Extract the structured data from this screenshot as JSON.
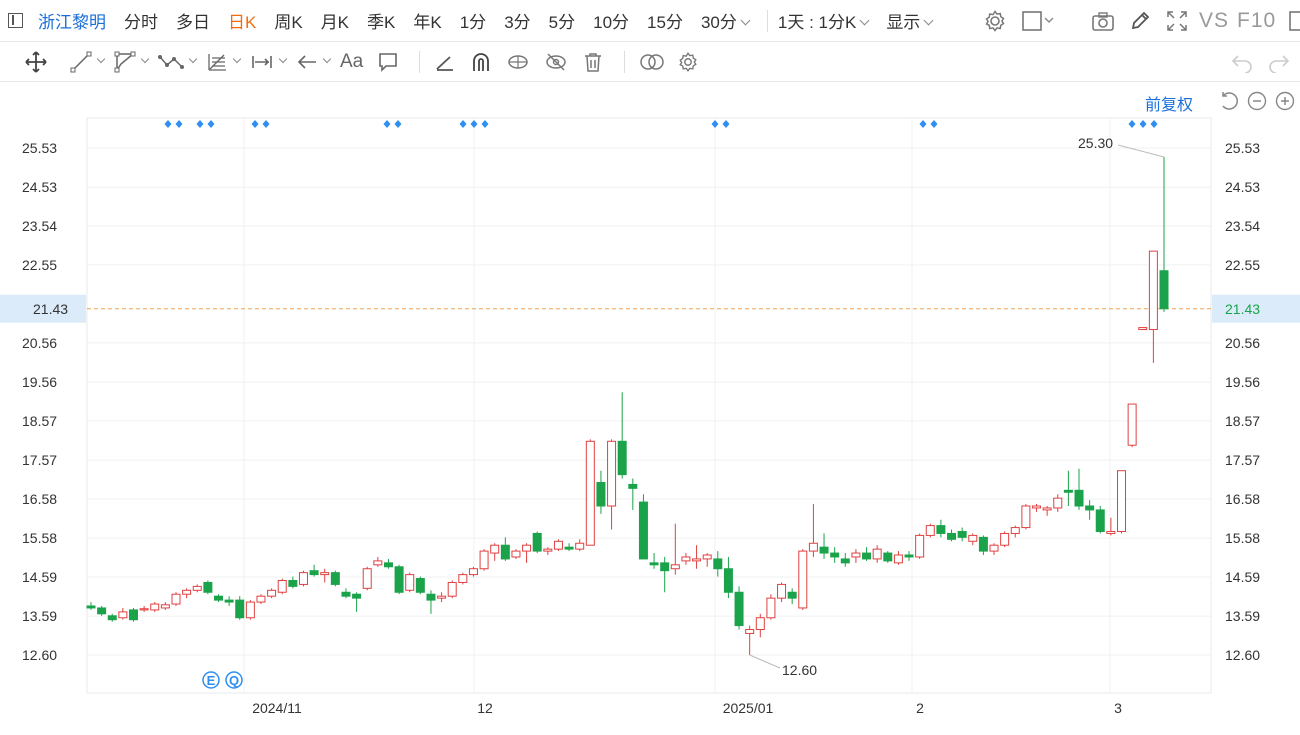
{
  "toolbar": {
    "stock_name": "浙江黎明",
    "periods": [
      "分时",
      "多日",
      "日K",
      "周K",
      "月K",
      "季K",
      "年K",
      "1分",
      "3分",
      "5分",
      "10分",
      "15分",
      "30分"
    ],
    "active_period": "日K",
    "combo": "1天 : 1分K",
    "display": "显示",
    "vs": "VS",
    "f10": "F10"
  },
  "drawing_tools": {
    "text_tool": "Aa"
  },
  "chart": {
    "adjust_label": "前复权",
    "current_price": "21.43",
    "high_label": "25.30",
    "low_label": "12.60"
  },
  "chart_data": {
    "type": "candlestick",
    "y_ticks": [
      "25.53",
      "24.53",
      "23.54",
      "22.55",
      "20.56",
      "19.56",
      "18.57",
      "17.57",
      "16.58",
      "15.58",
      "14.59",
      "13.59",
      "12.60"
    ],
    "x_labels": [
      "2024/11",
      "12",
      "2025/01",
      "2",
      "3"
    ],
    "current_price": 21.43,
    "max_label": 25.3,
    "min_label": 12.6,
    "colors": {
      "up": "#e04040",
      "down": "#1aa34a",
      "price_line": "#f0a050",
      "grid": "#f0f0f0"
    },
    "candles": [
      [
        13.85,
        13.95,
        13.75,
        13.8
      ],
      [
        13.8,
        13.85,
        13.6,
        13.65
      ],
      [
        13.6,
        13.65,
        13.45,
        13.5
      ],
      [
        13.55,
        13.8,
        13.5,
        13.7
      ],
      [
        13.75,
        13.8,
        13.45,
        13.5
      ],
      [
        13.75,
        13.85,
        13.7,
        13.78
      ],
      [
        13.75,
        13.95,
        13.7,
        13.9
      ],
      [
        13.8,
        13.95,
        13.75,
        13.88
      ],
      [
        13.9,
        14.2,
        13.85,
        14.15
      ],
      [
        14.15,
        14.3,
        14.05,
        14.25
      ],
      [
        14.25,
        14.4,
        14.2,
        14.35
      ],
      [
        14.45,
        14.5,
        14.15,
        14.2
      ],
      [
        14.1,
        14.15,
        13.95,
        14.0
      ],
      [
        14.0,
        14.1,
        13.85,
        13.95
      ],
      [
        14.0,
        14.1,
        13.5,
        13.55
      ],
      [
        13.55,
        14.0,
        13.5,
        13.95
      ],
      [
        13.95,
        14.15,
        13.9,
        14.1
      ],
      [
        14.1,
        14.3,
        14.05,
        14.25
      ],
      [
        14.2,
        14.55,
        14.15,
        14.5
      ],
      [
        14.5,
        14.6,
        14.3,
        14.35
      ],
      [
        14.4,
        14.75,
        14.35,
        14.7
      ],
      [
        14.75,
        14.9,
        14.6,
        14.65
      ],
      [
        14.65,
        14.8,
        14.45,
        14.7
      ],
      [
        14.7,
        14.75,
        14.35,
        14.4
      ],
      [
        14.2,
        14.3,
        14.05,
        14.1
      ],
      [
        14.15,
        14.2,
        13.7,
        14.05
      ],
      [
        14.3,
        14.85,
        14.25,
        14.8
      ],
      [
        14.9,
        15.1,
        14.85,
        15.0
      ],
      [
        14.95,
        15.05,
        14.8,
        14.85
      ],
      [
        14.85,
        14.9,
        14.15,
        14.2
      ],
      [
        14.25,
        14.7,
        14.2,
        14.65
      ],
      [
        14.55,
        14.6,
        14.15,
        14.2
      ],
      [
        14.15,
        14.25,
        13.65,
        14.0
      ],
      [
        14.05,
        14.2,
        13.95,
        14.1
      ],
      [
        14.1,
        14.5,
        14.05,
        14.45
      ],
      [
        14.45,
        14.7,
        14.4,
        14.65
      ],
      [
        14.65,
        14.85,
        14.6,
        14.8
      ],
      [
        14.8,
        15.3,
        14.75,
        15.25
      ],
      [
        15.2,
        15.45,
        15.0,
        15.4
      ],
      [
        15.4,
        15.6,
        15.0,
        15.05
      ],
      [
        15.1,
        15.3,
        15.05,
        15.25
      ],
      [
        15.25,
        15.45,
        14.95,
        15.4
      ],
      [
        15.7,
        15.75,
        15.2,
        15.25
      ],
      [
        15.25,
        15.35,
        15.15,
        15.3
      ],
      [
        15.3,
        15.55,
        15.25,
        15.5
      ],
      [
        15.35,
        15.45,
        15.25,
        15.3
      ],
      [
        15.3,
        15.55,
        15.25,
        15.45
      ],
      [
        15.4,
        18.1,
        15.4,
        18.05
      ],
      [
        17.0,
        17.3,
        16.2,
        16.4
      ],
      [
        16.4,
        18.1,
        15.8,
        18.05
      ],
      [
        18.05,
        19.3,
        17.1,
        17.2
      ],
      [
        16.95,
        17.1,
        16.3,
        16.85
      ],
      [
        16.5,
        16.7,
        15.1,
        15.05
      ],
      [
        14.95,
        15.2,
        14.8,
        14.9
      ],
      [
        14.95,
        15.1,
        14.2,
        14.75
      ],
      [
        14.8,
        15.95,
        14.65,
        14.9
      ],
      [
        15.0,
        15.2,
        14.9,
        15.1
      ],
      [
        15.0,
        15.4,
        14.8,
        15.05
      ],
      [
        15.05,
        15.2,
        14.85,
        15.15
      ],
      [
        15.05,
        15.25,
        14.6,
        14.8
      ],
      [
        14.8,
        15.1,
        14.05,
        14.2
      ],
      [
        14.2,
        14.35,
        13.25,
        13.35
      ],
      [
        13.15,
        13.35,
        12.6,
        13.25
      ],
      [
        13.25,
        13.65,
        13.05,
        13.55
      ],
      [
        13.55,
        14.15,
        13.5,
        14.05
      ],
      [
        14.05,
        14.45,
        13.95,
        14.4
      ],
      [
        14.2,
        14.3,
        13.9,
        14.05
      ],
      [
        13.8,
        15.3,
        13.75,
        15.25
      ],
      [
        15.25,
        16.45,
        15.1,
        15.45
      ],
      [
        15.35,
        15.7,
        15.05,
        15.2
      ],
      [
        15.2,
        15.35,
        14.95,
        15.1
      ],
      [
        15.05,
        15.2,
        14.85,
        14.95
      ],
      [
        15.1,
        15.3,
        14.95,
        15.2
      ],
      [
        15.2,
        15.35,
        15.0,
        15.05
      ],
      [
        15.05,
        15.4,
        14.95,
        15.3
      ],
      [
        15.2,
        15.25,
        14.95,
        15.0
      ],
      [
        14.95,
        15.25,
        14.9,
        15.15
      ],
      [
        15.15,
        15.25,
        15.0,
        15.1
      ],
      [
        15.1,
        15.7,
        15.05,
        15.65
      ],
      [
        15.65,
        15.95,
        15.6,
        15.9
      ],
      [
        15.9,
        16.05,
        15.6,
        15.7
      ],
      [
        15.7,
        15.8,
        15.5,
        15.55
      ],
      [
        15.75,
        15.85,
        15.5,
        15.6
      ],
      [
        15.5,
        15.7,
        15.4,
        15.65
      ],
      [
        15.6,
        15.65,
        15.15,
        15.25
      ],
      [
        15.25,
        15.45,
        15.15,
        15.4
      ],
      [
        15.4,
        15.75,
        15.35,
        15.7
      ],
      [
        15.7,
        15.9,
        15.6,
        15.85
      ],
      [
        15.85,
        16.45,
        15.8,
        16.4
      ],
      [
        16.35,
        16.45,
        16.25,
        16.4
      ],
      [
        16.3,
        16.4,
        16.15,
        16.35
      ],
      [
        16.35,
        16.7,
        16.25,
        16.6
      ],
      [
        16.8,
        17.3,
        16.4,
        16.75
      ],
      [
        16.8,
        17.35,
        16.3,
        16.4
      ],
      [
        16.4,
        16.55,
        16.05,
        16.3
      ],
      [
        16.3,
        16.4,
        15.7,
        15.75
      ],
      [
        15.7,
        16.1,
        15.65,
        15.75
      ],
      [
        15.75,
        17.3,
        15.7,
        17.3
      ],
      [
        17.95,
        19.0,
        17.9,
        19.0
      ],
      [
        20.9,
        20.95,
        20.9,
        20.95
      ],
      [
        20.9,
        22.9,
        20.05,
        22.9
      ],
      [
        22.4,
        25.3,
        21.35,
        21.43
      ]
    ]
  }
}
